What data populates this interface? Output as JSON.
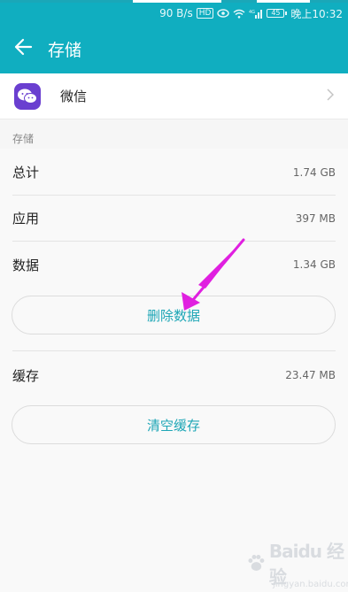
{
  "status_bar": {
    "net_speed": "90 B/s",
    "hd_badge": "HD",
    "signal": "4G",
    "battery": "45",
    "time": "晚上10:32"
  },
  "app_bar": {
    "title": "存储",
    "back_icon": "arrow-left-icon"
  },
  "app": {
    "name": "微信",
    "icon": "wechat-icon"
  },
  "section": {
    "label": "存储"
  },
  "rows": [
    {
      "label": "总计",
      "value": "1.74 GB"
    },
    {
      "label": "应用",
      "value": "397 MB"
    },
    {
      "label": "数据",
      "value": "1.34 GB"
    }
  ],
  "buttons": {
    "delete_data": "删除数据",
    "clear_cache": "清空缓存"
  },
  "cache": {
    "label": "缓存",
    "value": "23.47 MB"
  },
  "watermark": {
    "brand": "Baidu 经验",
    "url": "jingyan.baidu.com"
  },
  "colors": {
    "accent": "#10aec0",
    "button_text": "#1ea6b6",
    "annotation": "#e020e0"
  }
}
